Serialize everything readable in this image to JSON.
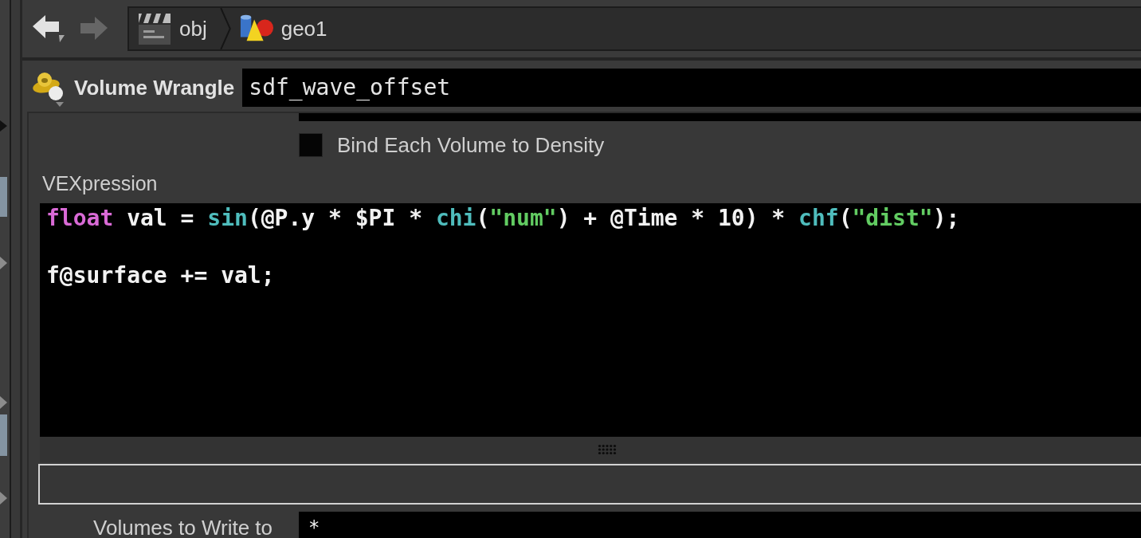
{
  "navigation": {
    "back": {
      "disabled": false
    },
    "forward": {
      "disabled": true
    },
    "path": [
      {
        "kind": "network",
        "label": "obj"
      },
      {
        "kind": "geometry",
        "label": "geo1"
      }
    ]
  },
  "node": {
    "type": "Volume Wrangle",
    "name": "sdf_wave_offset"
  },
  "parameters": [
    {
      "kind": "checkbox",
      "label": "Bind Each Volume to Density",
      "checked": false
    },
    {
      "kind": "code",
      "label": "VEXpression",
      "tokens": [
        {
          "kind": "keyword",
          "text": "float"
        },
        {
          "kind": "plain",
          "text": " val = "
        },
        {
          "kind": "function",
          "text": "sin"
        },
        {
          "kind": "plain",
          "text": "(@P.y * $PI * "
        },
        {
          "kind": "function",
          "text": "chi"
        },
        {
          "kind": "plain",
          "text": "("
        },
        {
          "kind": "string",
          "text": "\"num\""
        },
        {
          "kind": "plain",
          "text": ") + @Time * 10) * "
        },
        {
          "kind": "function",
          "text": "chf"
        },
        {
          "kind": "plain",
          "text": "("
        },
        {
          "kind": "string",
          "text": "\"dist\""
        },
        {
          "kind": "plain",
          "text": ");\n\nf@surface += val;"
        }
      ]
    },
    {
      "kind": "text",
      "label": "Volumes to Write to",
      "value": "*"
    }
  ]
}
